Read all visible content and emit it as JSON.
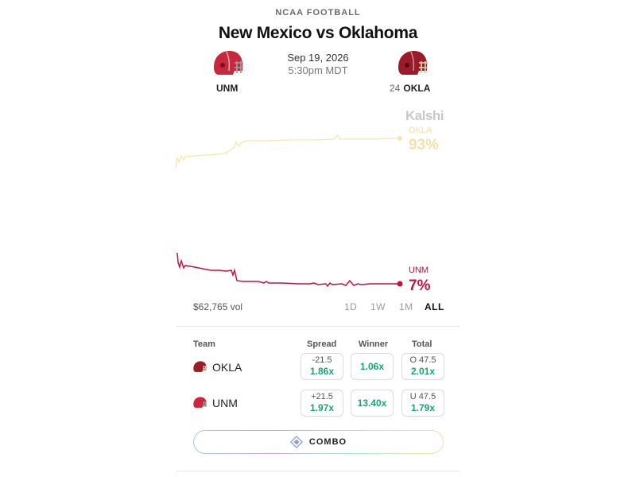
{
  "header": {
    "league": "NCAA FOOTBALL",
    "title": "New Mexico vs Oklahoma",
    "date": "Sep 19, 2026",
    "time": "5:30pm MDT"
  },
  "teams": {
    "away": {
      "abbr": "UNM",
      "rank": "",
      "helmet_color": "#c8283c"
    },
    "home": {
      "abbr": "OKLA",
      "rank": "24",
      "helmet_color": "#9a1c28"
    }
  },
  "chart": {
    "brand": "Kalshi",
    "okla_label": "OKLA",
    "okla_pct": "93%",
    "unm_label": "UNM",
    "unm_pct": "7%",
    "volume": "$62,765 vol",
    "ranges": [
      "1D",
      "1W",
      "1M",
      "ALL"
    ],
    "active_range": "ALL",
    "colors": {
      "okla": "#f3e2a8",
      "unm": "#c8103e"
    }
  },
  "table": {
    "headers": {
      "team": "Team",
      "spread": "Spread",
      "winner": "Winner",
      "total": "Total"
    },
    "rows": [
      {
        "team": "OKLA",
        "spread_line": "-21.5",
        "spread_odds": "1.86x",
        "winner_odds": "1.06x",
        "total_line": "O 47.5",
        "total_odds": "2.01x"
      },
      {
        "team": "UNM",
        "spread_line": "+21.5",
        "spread_odds": "1.97x",
        "winner_odds": "13.40x",
        "total_line": "U 47.5",
        "total_odds": "1.79x"
      }
    ]
  },
  "combo": {
    "label": "COMBO"
  },
  "chart_data": {
    "type": "line",
    "series": [
      {
        "name": "OKLA",
        "final": 93
      },
      {
        "name": "UNM",
        "final": 7
      }
    ],
    "ylim": [
      0,
      100
    ]
  }
}
